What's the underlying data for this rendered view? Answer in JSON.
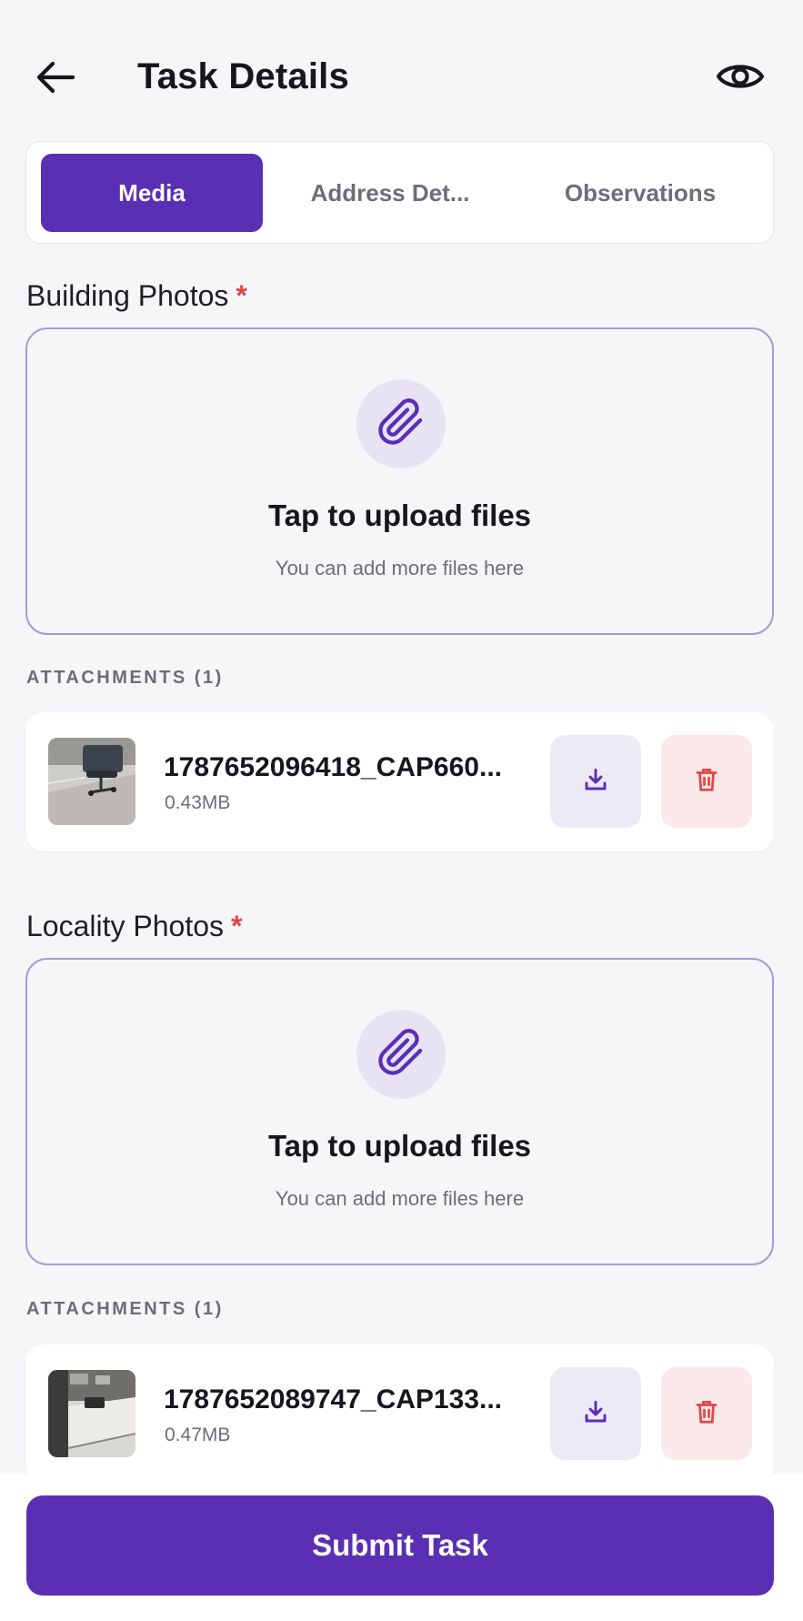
{
  "header": {
    "title": "Task Details",
    "back_icon": "arrow-left-icon",
    "preview_icon": "eye-icon"
  },
  "tabs": [
    {
      "label": "Media",
      "active": true
    },
    {
      "label": "Address Det...",
      "active": false
    },
    {
      "label": "Observations",
      "active": false
    }
  ],
  "sections": [
    {
      "label": "Building Photos",
      "required_mark": "*",
      "upload": {
        "icon": "paperclip-icon",
        "title": "Tap to upload files",
        "subtitle": "You can add more files here"
      },
      "attachments_label": "ATTACHMENTS (1)",
      "attachments": [
        {
          "name": "1787652096418_CAP660...",
          "size": "0.43MB",
          "download_icon": "download-icon",
          "delete_icon": "trash-icon"
        }
      ]
    },
    {
      "label": "Locality Photos",
      "required_mark": "*",
      "upload": {
        "icon": "paperclip-icon",
        "title": "Tap to upload files",
        "subtitle": "You can add more files here"
      },
      "attachments_label": "ATTACHMENTS (1)",
      "attachments": [
        {
          "name": "1787652089747_CAP133...",
          "size": "0.47MB",
          "download_icon": "download-icon",
          "delete_icon": "trash-icon"
        }
      ]
    }
  ],
  "footer": {
    "submit_label": "Submit Task"
  },
  "colors": {
    "accent": "#5b2fb4",
    "required": "#e04848",
    "delete": "#e04848",
    "upload_border": "#a79ad6",
    "background": "#f6f6f9"
  }
}
